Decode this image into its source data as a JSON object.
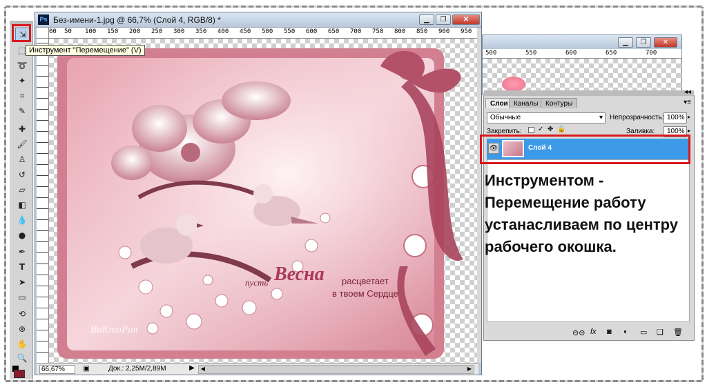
{
  "document": {
    "title": "Без-имени-1.jpg @ 66,7% (Слой 4, RGB/8) *",
    "app_icon": "Ps",
    "ruler_labels": [
      "00",
      "50",
      "100",
      "150",
      "200",
      "250",
      "300",
      "350",
      "400",
      "450",
      "500",
      "550",
      "600",
      "650",
      "700",
      "750",
      "800",
      "850",
      "900",
      "950"
    ],
    "zoom": "66,67%",
    "doc_info": "Док.: 2,25M/2,89M",
    "canvas_text_line1": "пусть",
    "canvas_text_word": "Весна",
    "canvas_text_line2": "расцветает",
    "canvas_text_line3": "в твоем Сердце",
    "signature": "ВиКтоРия"
  },
  "back_window": {
    "ruler_labels": [
      "500",
      "550",
      "600",
      "650",
      "700"
    ]
  },
  "tooltip": "Инструмент \"Перемещение\" (V)",
  "layers_panel": {
    "tabs": [
      "Слои",
      "Каналы",
      "Контуры"
    ],
    "blend_mode": "Обычные",
    "opacity_label": "Непрозрачность:",
    "opacity_value": "100%",
    "lock_label": "Закрепить:",
    "fill_label": "Заливка:",
    "fill_value": "100%",
    "layer_name": "Слой 4"
  },
  "instruction_text": "Инструментом - Перемещение работу устанасливаем по центру рабочего окошка.",
  "colors": {
    "accent_red": "#d7191f",
    "layer_selected": "#3d9ae8",
    "foreground_swatch": "#8b1a2b"
  }
}
